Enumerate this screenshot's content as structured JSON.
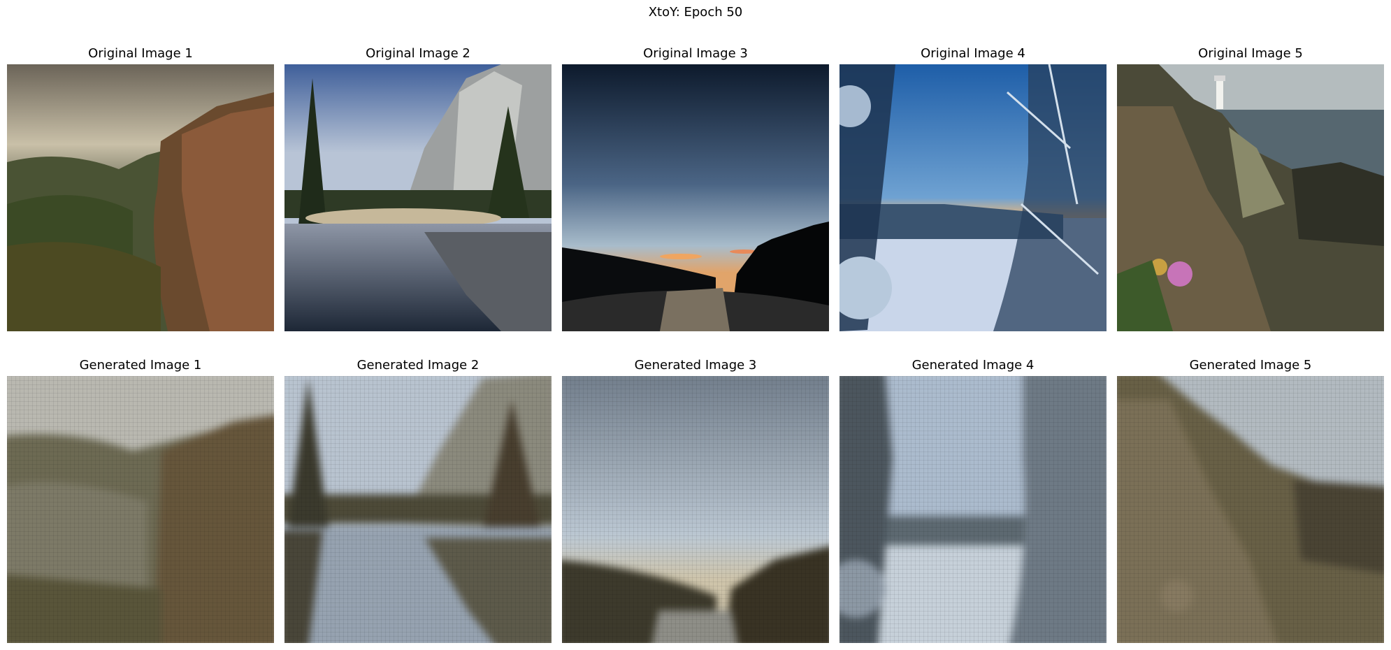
{
  "figure": {
    "suptitle": "XtoY: Epoch 50"
  },
  "original": [
    {
      "title": "Original Image 1",
      "scene": "cliff-valley-landscape"
    },
    {
      "title": "Original Image 2",
      "scene": "granite-cliff-lake-reflection"
    },
    {
      "title": "Original Image 3",
      "scene": "sunset-river-forest"
    },
    {
      "title": "Original Image 4",
      "scene": "snowy-trees-frozen-lake"
    },
    {
      "title": "Original Image 5",
      "scene": "lighthouse-on-rocky-coast"
    }
  ],
  "generated": [
    {
      "title": "Generated Image 1",
      "scene": "cliff-valley-landscape-blurred"
    },
    {
      "title": "Generated Image 2",
      "scene": "granite-cliff-lake-reflection-blurred"
    },
    {
      "title": "Generated Image 3",
      "scene": "sunset-river-forest-blurred"
    },
    {
      "title": "Generated Image 4",
      "scene": "snowy-trees-frozen-lake-blurred"
    },
    {
      "title": "Generated Image 5",
      "scene": "lighthouse-on-rocky-coast-blurred"
    }
  ]
}
